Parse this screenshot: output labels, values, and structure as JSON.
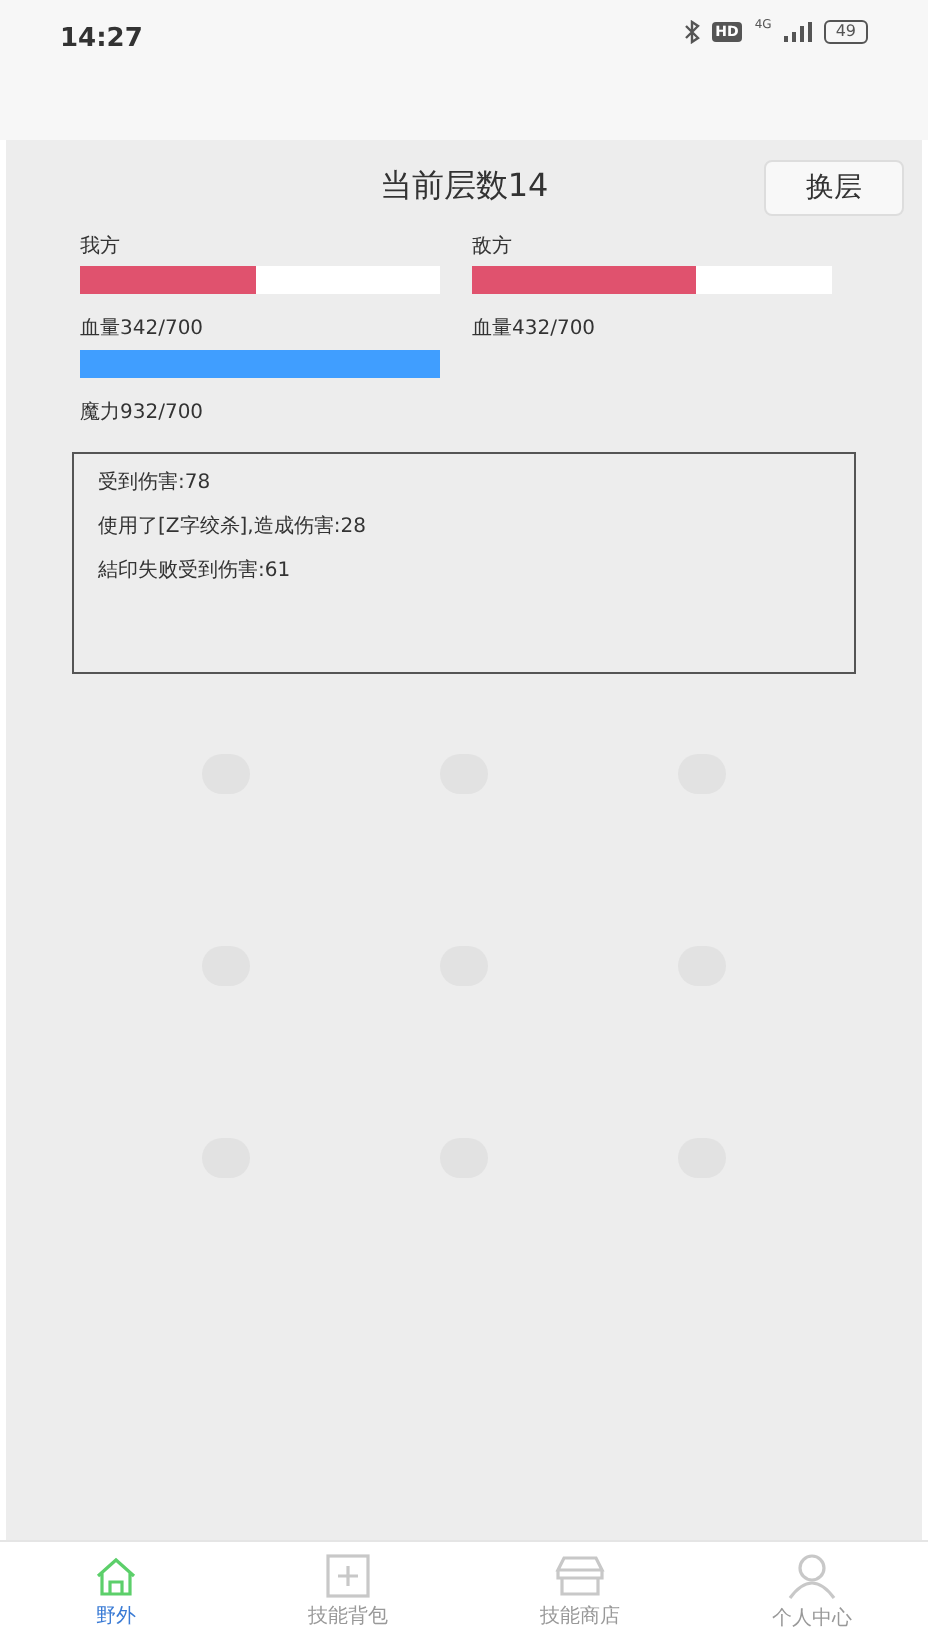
{
  "status_bar": {
    "time": "14:27",
    "hd": "HD",
    "network": "4G",
    "battery": "49"
  },
  "header": {
    "title": "当前层数14",
    "button": "换层"
  },
  "player": {
    "name": "我方",
    "hp": {
      "level": 0.49,
      "reading": "血量342/700"
    },
    "mp": {
      "level": 1,
      "reading": "魔力932/700"
    }
  },
  "enemy": {
    "name": "敌方",
    "hp": {
      "level": 0.62,
      "reading": "血量432/700"
    }
  },
  "log": [
    "受到伤害:78",
    "使用了[Z字绞杀],造成伤害:28",
    "結印失败受到伤害:61"
  ],
  "tabs": [
    {
      "label": "野外",
      "kind": "home",
      "selected": true
    },
    {
      "label": "技能背包",
      "kind": "bag",
      "selected": false
    },
    {
      "label": "技能商店",
      "kind": "shop",
      "selected": false
    },
    {
      "label": "个人中心",
      "kind": "user",
      "selected": false
    }
  ]
}
